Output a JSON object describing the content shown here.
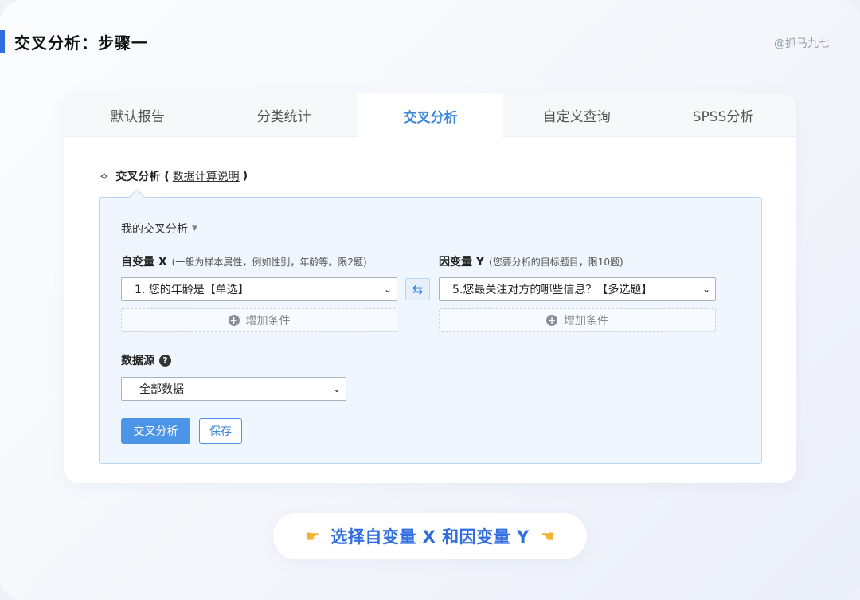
{
  "slide": {
    "title": "交叉分析：步骤一",
    "watermark": "@抓马九七"
  },
  "tabs": [
    {
      "label": "默认报告",
      "active": false
    },
    {
      "label": "分类统计",
      "active": false
    },
    {
      "label": "交叉分析",
      "active": true
    },
    {
      "label": "自定义查询",
      "active": false
    },
    {
      "label": "SPSS分析",
      "active": false
    }
  ],
  "section": {
    "title": "交叉分析 (",
    "link": "数据计算说明",
    "close": ")"
  },
  "panel": {
    "my_analysis": "我的交叉分析",
    "var_x": {
      "label": "自变量 X",
      "hint": "(一般为样本属性，例如性别，年龄等。限2题)",
      "selected": "1. 您的年龄是【单选】",
      "add_condition": "增加条件"
    },
    "var_y": {
      "label": "因变量 Y",
      "hint": "(您要分析的目标题目，限10题)",
      "selected": "5.您最关注对方的哪些信息？【多选题】",
      "add_condition": "增加条件"
    },
    "data_source": {
      "label": "数据源",
      "selected": "全部数据"
    },
    "buttons": {
      "analyze": "交叉分析",
      "save": "保存"
    }
  },
  "caption": {
    "text": "选择自变量 X 和因变量 Y"
  },
  "colors": {
    "accent": "#2f6de1",
    "tab_active": "#3a86d8",
    "primary_button": "#4c94e6",
    "panel_bg": "#f0f6fd",
    "panel_border": "#b9d6f2"
  }
}
